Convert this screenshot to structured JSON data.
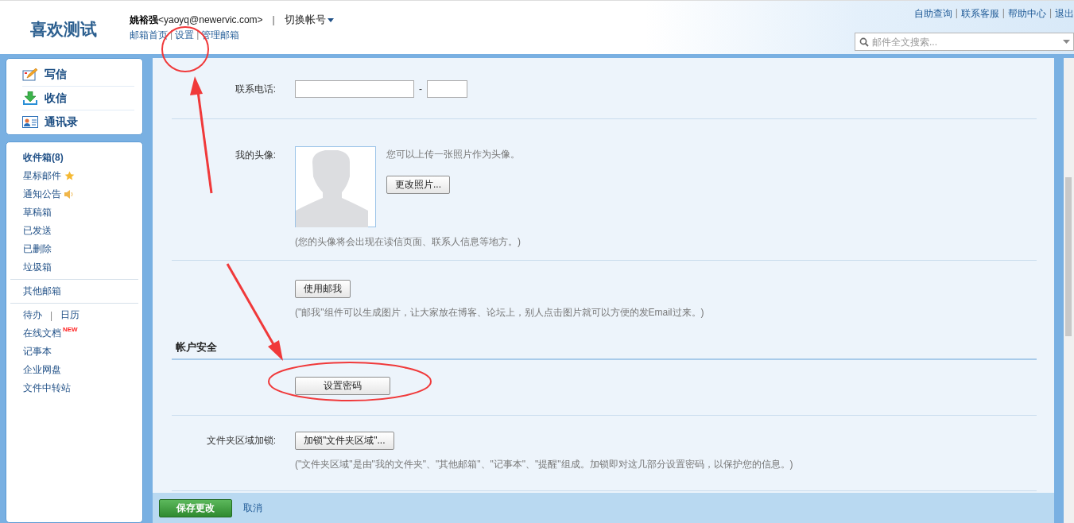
{
  "header": {
    "logo": "喜欢测试",
    "user_name": "姚裕强",
    "user_email": "<yaoyq@newervic.com>",
    "separator": "|",
    "switch_account": "切换帐号",
    "nav_links": [
      {
        "label": "邮箱首页"
      },
      {
        "label": "设置"
      },
      {
        "label": "管理邮箱"
      }
    ],
    "nav_separator": "|",
    "top_links": [
      {
        "label": "自助查询"
      },
      {
        "label": "联系客服"
      },
      {
        "label": "帮助中心"
      },
      {
        "label": "退出"
      }
    ],
    "search": {
      "placeholder": "邮件全文搜索..."
    }
  },
  "sidebar": {
    "actions": [
      {
        "label": "写信",
        "kind": "compose"
      },
      {
        "label": "收信",
        "kind": "receive"
      },
      {
        "label": "通讯录",
        "kind": "contacts"
      }
    ],
    "folder_groups": [
      [
        {
          "kind": "inbox",
          "label": "收件箱(8)"
        },
        {
          "kind": "starred",
          "label": "星标邮件"
        },
        {
          "kind": "notice",
          "label": "通知公告"
        },
        {
          "kind": "link",
          "label": "草稿箱"
        },
        {
          "kind": "link",
          "label": "已发送"
        },
        {
          "kind": "link",
          "label": "已删除"
        },
        {
          "kind": "link",
          "label": "垃圾箱"
        }
      ],
      [
        {
          "kind": "link",
          "label": "其他邮箱"
        }
      ],
      [
        {
          "kind": "pair",
          "label": "待办",
          "separator": "|",
          "label_2": "日历"
        },
        {
          "kind": "link",
          "label": "在线文档",
          "badge": "NEW"
        },
        {
          "kind": "link",
          "label": "记事本"
        },
        {
          "kind": "link",
          "label": "企业网盘"
        },
        {
          "kind": "link",
          "label": "文件中转站"
        }
      ]
    ]
  },
  "settings": {
    "rows": [
      {
        "kind": "phone",
        "label": "联系电话:",
        "separator": "-",
        "divider": true
      },
      {
        "kind": "avatar",
        "label": "我的头像:",
        "hint": "您可以上传一张照片作为头像。",
        "button": "更改照片...",
        "caption": "(您的头像将会出现在读信页面、联系人信息等地方。)",
        "divider": true
      },
      {
        "kind": "button",
        "button": "使用邮我",
        "caption": "(\"邮我\"组件可以生成图片，让大家放在博客、论坛上，别人点击图片就可以方便的发Email过来。)",
        "divider": false
      },
      {
        "kind": "section",
        "title": "帐户安全",
        "divider": false
      },
      {
        "kind": "button",
        "button": "设置密码",
        "wide": true,
        "divider": true
      },
      {
        "kind": "lock",
        "label": "文件夹区域加锁:",
        "button": "加锁\"文件夹区域\"...",
        "caption": "(\"文件夹区域\"是由\"我的文件夹\"、\"其他邮箱\"、\"记事本\"、\"提醒\"组成。加锁即对这几部分设置密码，以保护您的信息。)",
        "divider": true
      }
    ]
  },
  "footer": {
    "save": "保存更改",
    "cancel": "取消"
  }
}
